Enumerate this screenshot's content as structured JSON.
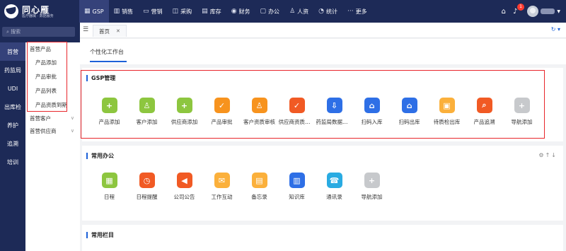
{
  "brand": {
    "name": "同心雁",
    "subtitle": "医疗器械 · 数据服务"
  },
  "topnav": [
    {
      "label": "GSP",
      "icon": "grid-icon",
      "glyph": "▦",
      "active": true
    },
    {
      "label": "销售",
      "icon": "chart-icon",
      "glyph": "▥",
      "active": false
    },
    {
      "label": "营销",
      "icon": "megaphone-icon",
      "glyph": "▭",
      "active": false
    },
    {
      "label": "采购",
      "icon": "cart-icon",
      "glyph": "◫",
      "active": false
    },
    {
      "label": "库存",
      "icon": "warehouse-icon",
      "glyph": "▤",
      "active": false
    },
    {
      "label": "财务",
      "icon": "finance-icon",
      "glyph": "◉",
      "active": false
    },
    {
      "label": "办公",
      "icon": "briefcase-icon",
      "glyph": "▢",
      "active": false
    },
    {
      "label": "人资",
      "icon": "person-icon",
      "glyph": "♙",
      "active": false
    },
    {
      "label": "统计",
      "icon": "stats-icon",
      "glyph": "◔",
      "active": false
    },
    {
      "label": "更多",
      "icon": "more-icon",
      "glyph": "···",
      "active": false
    }
  ],
  "topright": {
    "badge_count": "1"
  },
  "sidebar": {
    "search_placeholder": "搜索",
    "primary": [
      "首营",
      "药监局",
      "UDI",
      "出库检",
      "养护",
      "追溯",
      "培训"
    ],
    "groups": [
      {
        "label": "首营产品",
        "expanded": true,
        "items": [
          "产品添加",
          "产品审批",
          "产品列表",
          "产品资质到期"
        ]
      },
      {
        "label": "首营客户",
        "expanded": false,
        "items": []
      },
      {
        "label": "首营供应商",
        "expanded": false,
        "items": []
      }
    ]
  },
  "tabs": {
    "current": "首页"
  },
  "workspace": {
    "tab": "个性化工作台"
  },
  "gsp": {
    "title": "GSP管理",
    "apps": [
      {
        "label": "产品添加",
        "color": "#8dc63f",
        "icon": "product-add-icon",
        "glyph": "+"
      },
      {
        "label": "客户添加",
        "color": "#8dc63f",
        "icon": "customer-add-icon",
        "glyph": "♙"
      },
      {
        "label": "供应商添加",
        "color": "#8dc63f",
        "icon": "supplier-add-icon",
        "glyph": "+"
      },
      {
        "label": "产品审批",
        "color": "#f7931e",
        "icon": "product-approve-icon",
        "glyph": "✓"
      },
      {
        "label": "客户资质审核",
        "color": "#f7931e",
        "icon": "customer-review-icon",
        "glyph": "♙"
      },
      {
        "label": "供应商资质审核",
        "color": "#f15a24",
        "icon": "supplier-review-icon",
        "glyph": "✓"
      },
      {
        "label": "药监局数据下载",
        "color": "#2e6fe6",
        "icon": "download-data-icon",
        "glyph": "⇩"
      },
      {
        "label": "扫码入库",
        "color": "#2e6fe6",
        "icon": "scan-in-icon",
        "glyph": "⌂"
      },
      {
        "label": "扫码出库",
        "color": "#2e6fe6",
        "icon": "scan-out-icon",
        "glyph": "⌂"
      },
      {
        "label": "待质检出库",
        "color": "#fbb03b",
        "icon": "inspection-icon",
        "glyph": "▣"
      },
      {
        "label": "产品追溯",
        "color": "#f15a24",
        "icon": "trace-icon",
        "glyph": "⌕"
      },
      {
        "label": "导航添加",
        "color": "#c7c9cc",
        "icon": "nav-add-icon",
        "glyph": "+"
      }
    ]
  },
  "office": {
    "title": "常用办公",
    "apps": [
      {
        "label": "日程",
        "color": "#8dc63f",
        "icon": "calendar-icon",
        "glyph": "▦"
      },
      {
        "label": "日程提醒",
        "color": "#f15a24",
        "icon": "reminder-icon",
        "glyph": "◷"
      },
      {
        "label": "公司公告",
        "color": "#f15a24",
        "icon": "announcement-icon",
        "glyph": "◀"
      },
      {
        "label": "工作互动",
        "color": "#fbb03b",
        "icon": "interaction-icon",
        "glyph": "✉"
      },
      {
        "label": "备忘录",
        "color": "#fbb03b",
        "icon": "memo-icon",
        "glyph": "▤"
      },
      {
        "label": "知识库",
        "color": "#2e6fe6",
        "icon": "knowledge-icon",
        "glyph": "▥"
      },
      {
        "label": "通讯录",
        "color": "#29abe2",
        "icon": "contacts-icon",
        "glyph": "☎"
      },
      {
        "label": "导航添加",
        "color": "#c7c9cc",
        "icon": "nav-add-icon",
        "glyph": "+"
      }
    ]
  },
  "columns": {
    "title": "常用栏目"
  }
}
